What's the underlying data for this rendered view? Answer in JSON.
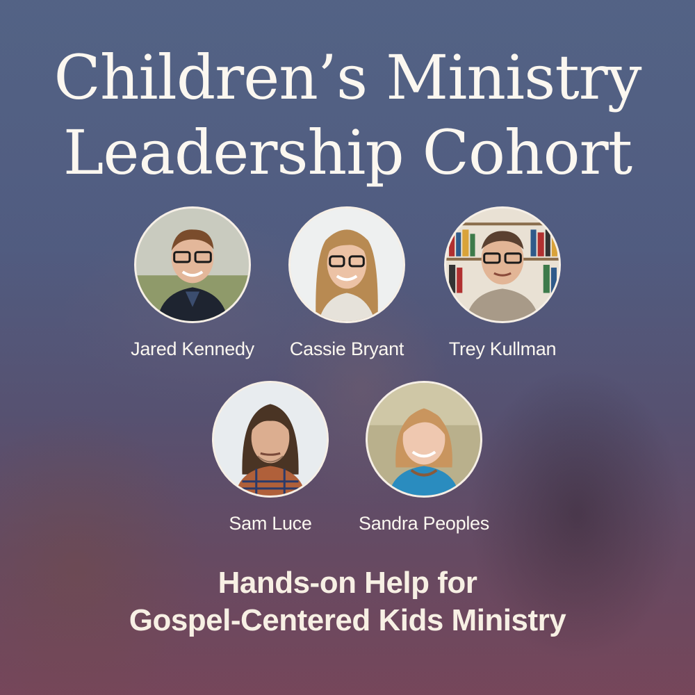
{
  "title": {
    "line1": "Children’s Ministry",
    "line2": "Leadership Cohort"
  },
  "speakers": [
    {
      "name": "Jared Kennedy"
    },
    {
      "name": "Cassie Bryant"
    },
    {
      "name": "Trey Kullman"
    },
    {
      "name": "Sam Luce"
    },
    {
      "name": "Sandra Peoples"
    }
  ],
  "tagline": {
    "line1": "Hands-on Help for",
    "line2": "Gospel-Centered Kids Ministry"
  },
  "colors": {
    "text": "#fbf7f0",
    "overlay": "#55648a"
  }
}
